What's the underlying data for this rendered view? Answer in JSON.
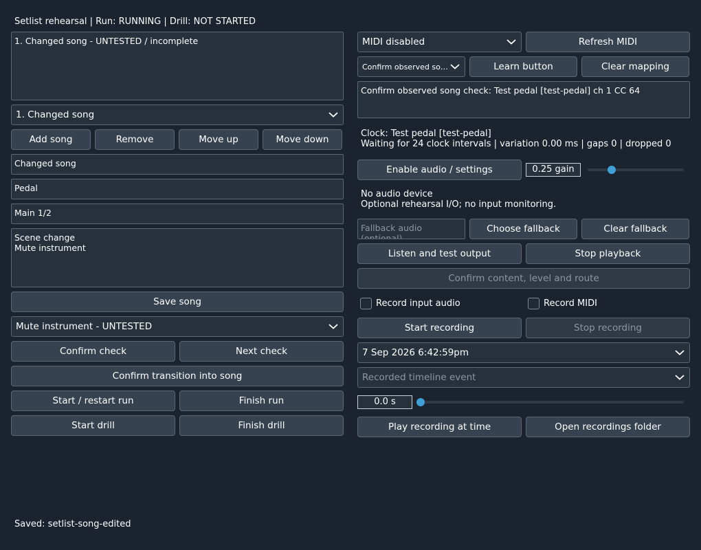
{
  "status_line": "Setlist rehearsal | Run: RUNNING | Drill: NOT STARTED",
  "left": {
    "song_list_text": "1. Changed song - UNTESTED / incomplete",
    "song_select": "1. Changed song",
    "buttons": {
      "add_song": "Add song",
      "remove": "Remove",
      "move_up": "Move up",
      "move_down": "Move down",
      "save_song": "Save song",
      "confirm_check": "Confirm check",
      "next_check": "Next check",
      "confirm_transition": "Confirm transition into song",
      "start_restart_run": "Start / restart run",
      "finish_run": "Finish run",
      "start_drill": "Start drill",
      "finish_drill": "Finish drill"
    },
    "song_name_value": "Changed song",
    "pedal_value": "Pedal",
    "patch_value": "Main 1/2",
    "notes_value": "Scene change\nMute instrument",
    "check_select": "Mute instrument - UNTESTED"
  },
  "right": {
    "midi_select": "MIDI disabled",
    "refresh_midi": "Refresh MIDI",
    "mapping_select": "Confirm observed song...",
    "learn_button": "Learn button",
    "clear_mapping": "Clear mapping",
    "mapping_text": "Confirm observed song check: Test pedal [test-pedal] ch 1 CC 64",
    "clock_line1": "Clock: Test pedal [test-pedal]",
    "clock_line2": "Waiting for 24 clock intervals | variation 0.00 ms | gaps 0 | dropped 0",
    "enable_audio": "Enable audio / settings",
    "gain_text": "0.25 gain",
    "gain_fraction": 0.25,
    "audio_status1": "No audio device",
    "audio_status2": "Optional rehearsal I/O; no input monitoring.",
    "fallback_placeholder": "Fallback audio (optional)",
    "choose_fallback": "Choose fallback",
    "clear_fallback": "Clear fallback",
    "listen_test": "Listen and test output",
    "stop_playback": "Stop playback",
    "confirm_content": "Confirm content, level and route",
    "record_input_audio": "Record input audio",
    "record_midi": "Record MIDI",
    "start_recording": "Start recording",
    "stop_recording": "Stop recording",
    "date_select": "7 Sep 2026 6:42:59pm",
    "timeline_placeholder": "Recorded timeline event",
    "time_text": "0.0 s",
    "time_fraction": 0.0,
    "play_recording": "Play recording at time",
    "open_folder": "Open recordings folder"
  },
  "footer": "Saved: setlist-song-edited",
  "icons": {
    "dropdown": "chevron-down-icon",
    "checkbox": "checkbox-icon"
  },
  "colors": {
    "background": "#1a232e",
    "button": "#36424f",
    "slider": "#3fa0d8"
  }
}
